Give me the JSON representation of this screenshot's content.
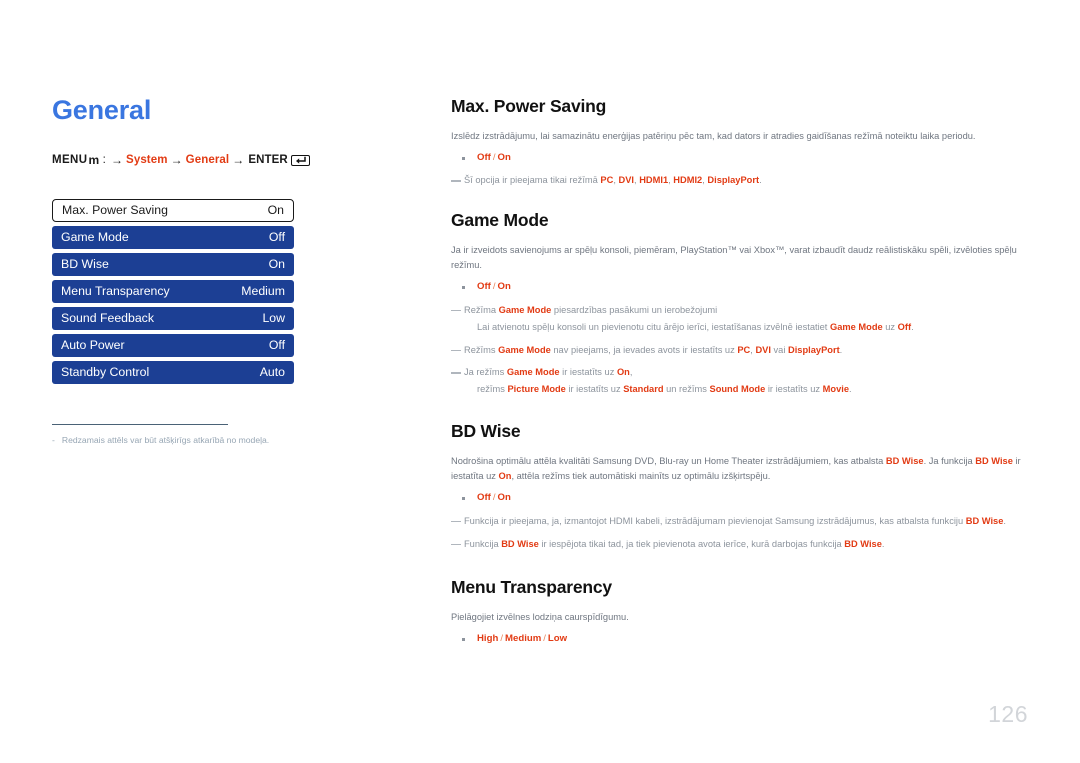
{
  "page": {
    "title": "General",
    "number": "126"
  },
  "breadcrumb": {
    "menu_label": "MENU",
    "menu_icon_glyph": "m",
    "colon": ":",
    "arrow": "→",
    "step1": "System",
    "step2": "General",
    "enter_label": "ENTER",
    "enter_icon": "enter-key-icon"
  },
  "osd_menu": {
    "rows": [
      {
        "label": "Max. Power Saving",
        "value": "On",
        "state": "selected"
      },
      {
        "label": "Game Mode",
        "value": "Off",
        "state": "normal"
      },
      {
        "label": "BD Wise",
        "value": "On",
        "state": "normal"
      },
      {
        "label": "Menu Transparency",
        "value": "Medium",
        "state": "normal"
      },
      {
        "label": "Sound Feedback",
        "value": "Low",
        "state": "normal"
      },
      {
        "label": "Auto Power",
        "value": "Off",
        "state": "normal"
      },
      {
        "label": "Standby Control",
        "value": "Auto",
        "state": "normal"
      }
    ]
  },
  "left_note": {
    "dash": "-",
    "text": "Redzamais attēls var būt atšķirīgs atkarībā no modeļa."
  },
  "sections": [
    {
      "id": "max-power-saving",
      "title": "Max. Power Saving",
      "body": "Izslēdz izstrādājumu, lai samazinātu enerģijas patēriņu pēc tam, kad dators ir atradies gaidīšanas režīmā noteiktu laika periodu.",
      "options": [
        "Off",
        "On"
      ],
      "notes": [
        {
          "parts": [
            {
              "t": "Šī opcija ir pieejama tikai režīmā ",
              "b": false
            },
            {
              "t": "PC",
              "b": true
            },
            {
              "t": ", ",
              "b": false
            },
            {
              "t": "DVI",
              "b": true
            },
            {
              "t": ", ",
              "b": false
            },
            {
              "t": "HDMI1",
              "b": true
            },
            {
              "t": ", ",
              "b": false
            },
            {
              "t": "HDMI2",
              "b": true
            },
            {
              "t": ", ",
              "b": false
            },
            {
              "t": "DisplayPort",
              "b": true
            },
            {
              "t": ".",
              "b": false
            }
          ]
        }
      ]
    },
    {
      "id": "game-mode",
      "title": "Game Mode",
      "body": "Ja ir izveidots savienojums ar spēļu konsoli, piemēram, PlayStation™ vai Xbox™, varat izbaudīt daudz reālistiskāku spēli, izvēloties spēļu režīmu.",
      "options": [
        "Off",
        "On"
      ],
      "notes": [
        {
          "parts": [
            {
              "t": "Režīma ",
              "b": false
            },
            {
              "t": "Game Mode",
              "b": true
            },
            {
              "t": " piesardzības pasākumi un ierobežojumi",
              "b": false
            }
          ],
          "sub": [
            {
              "t": "Lai atvienotu spēļu konsoli un pievienotu citu ārējo ierīci, iestatīšanas izvēlnē iestatiet ",
              "b": false
            },
            {
              "t": "Game Mode",
              "b": true
            },
            {
              "t": " uz ",
              "b": false
            },
            {
              "t": "Off",
              "b": true
            },
            {
              "t": ".",
              "b": false
            }
          ]
        },
        {
          "parts": [
            {
              "t": "Režīms ",
              "b": false
            },
            {
              "t": "Game Mode",
              "b": true
            },
            {
              "t": " nav pieejams, ja ievades avots ir iestatīts uz ",
              "b": false
            },
            {
              "t": "PC",
              "b": true
            },
            {
              "t": ", ",
              "b": false
            },
            {
              "t": "DVI",
              "b": true
            },
            {
              "t": " vai ",
              "b": false
            },
            {
              "t": "DisplayPort",
              "b": true
            },
            {
              "t": ".",
              "b": false
            }
          ]
        },
        {
          "parts": [
            {
              "t": "Ja režīms ",
              "b": false
            },
            {
              "t": "Game Mode",
              "b": true
            },
            {
              "t": " ir iestatīts uz ",
              "b": false
            },
            {
              "t": "On",
              "b": true
            },
            {
              "t": ",",
              "b": false
            }
          ],
          "sub": [
            {
              "t": "režīms ",
              "b": false
            },
            {
              "t": "Picture Mode",
              "b": true
            },
            {
              "t": " ir iestatīts uz ",
              "b": false
            },
            {
              "t": "Standard",
              "b": true
            },
            {
              "t": " un režīms ",
              "b": false
            },
            {
              "t": "Sound Mode",
              "b": true
            },
            {
              "t": " ir iestatīts uz ",
              "b": false
            },
            {
              "t": "Movie",
              "b": true
            },
            {
              "t": ".",
              "b": false
            }
          ]
        }
      ]
    },
    {
      "id": "bd-wise",
      "title": "BD Wise",
      "body_parts": [
        {
          "t": "Nodrošina optimālu attēla kvalitāti Samsung DVD, Blu-ray un Home Theater izstrādājumiem, kas atbalsta ",
          "b": false
        },
        {
          "t": "BD Wise",
          "b": true
        },
        {
          "t": ". Ja funkcija ",
          "b": false
        },
        {
          "t": "BD Wise",
          "b": true
        },
        {
          "t": " ir iestatīta uz ",
          "b": false
        },
        {
          "t": "On",
          "b": true
        },
        {
          "t": ", attēla režīms tiek automātiski mainīts uz optimālu izšķirtspēju.",
          "b": false
        }
      ],
      "options": [
        "Off",
        "On"
      ],
      "notes": [
        {
          "parts": [
            {
              "t": "Funkcija ir pieejama, ja, izmantojot HDMI kabeli, izstrādājumam pievienojat Samsung izstrādājumus, kas atbalsta funkciju ",
              "b": false
            },
            {
              "t": "BD Wise",
              "b": true
            },
            {
              "t": ".",
              "b": false
            }
          ]
        },
        {
          "parts": [
            {
              "t": "Funkcija ",
              "b": false
            },
            {
              "t": "BD Wise",
              "b": true
            },
            {
              "t": " ir iespējota tikai tad, ja tiek pievienota avota ierīce, kurā darbojas funkcija ",
              "b": false
            },
            {
              "t": "BD Wise",
              "b": true
            },
            {
              "t": ".",
              "b": false
            }
          ]
        }
      ]
    },
    {
      "id": "menu-transparency",
      "title": "Menu Transparency",
      "body": "Pielāgojiet izvēlnes lodziņa caurspīdīgumu.",
      "options": [
        "High",
        "Medium",
        "Low"
      ],
      "notes": []
    }
  ],
  "colors": {
    "title_blue": "#3a76e0",
    "accent_red": "#e23b14",
    "osd_blue": "#1c3f94",
    "body_gray": "#6f7680",
    "note_gray": "#8d949d",
    "divider": "#4a6276",
    "page_number": "#d2d5d9"
  }
}
